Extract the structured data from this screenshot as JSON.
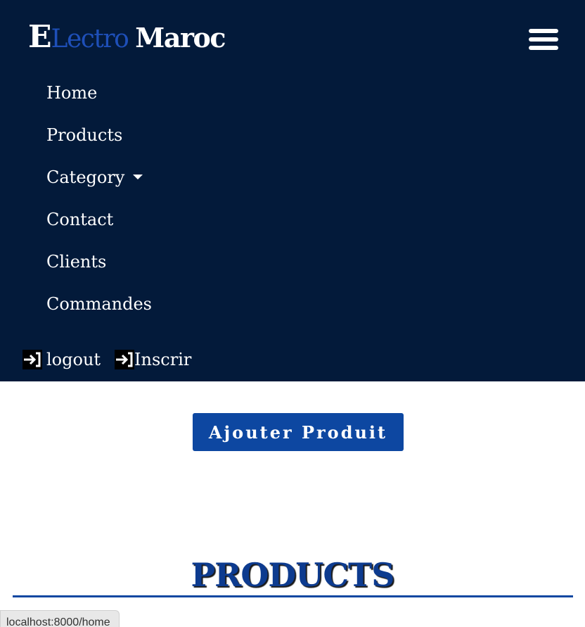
{
  "brand": {
    "initial": "E",
    "lectro": "Lectro",
    "maroc": "Maroc"
  },
  "nav": {
    "items": [
      {
        "label": "Home"
      },
      {
        "label": "Products"
      },
      {
        "label": "Category"
      },
      {
        "label": "Contact"
      },
      {
        "label": "Clients"
      },
      {
        "label": "Commandes"
      }
    ],
    "toggle_icon": "hamburger-menu-icon"
  },
  "auth": {
    "logout_label": "logout",
    "register_label": "Inscrir",
    "icon": "login-arrow-icon"
  },
  "main": {
    "add_button_label": "Ajouter Produit",
    "section_title": "PRODUCTS"
  },
  "status_bar": {
    "url": "localhost:8000/home"
  },
  "colors": {
    "navbar_bg": "#031a3a",
    "brand_accent": "#1e4fb8",
    "primary_button": "#0d47a1",
    "title_color": "#0d3b8f"
  }
}
